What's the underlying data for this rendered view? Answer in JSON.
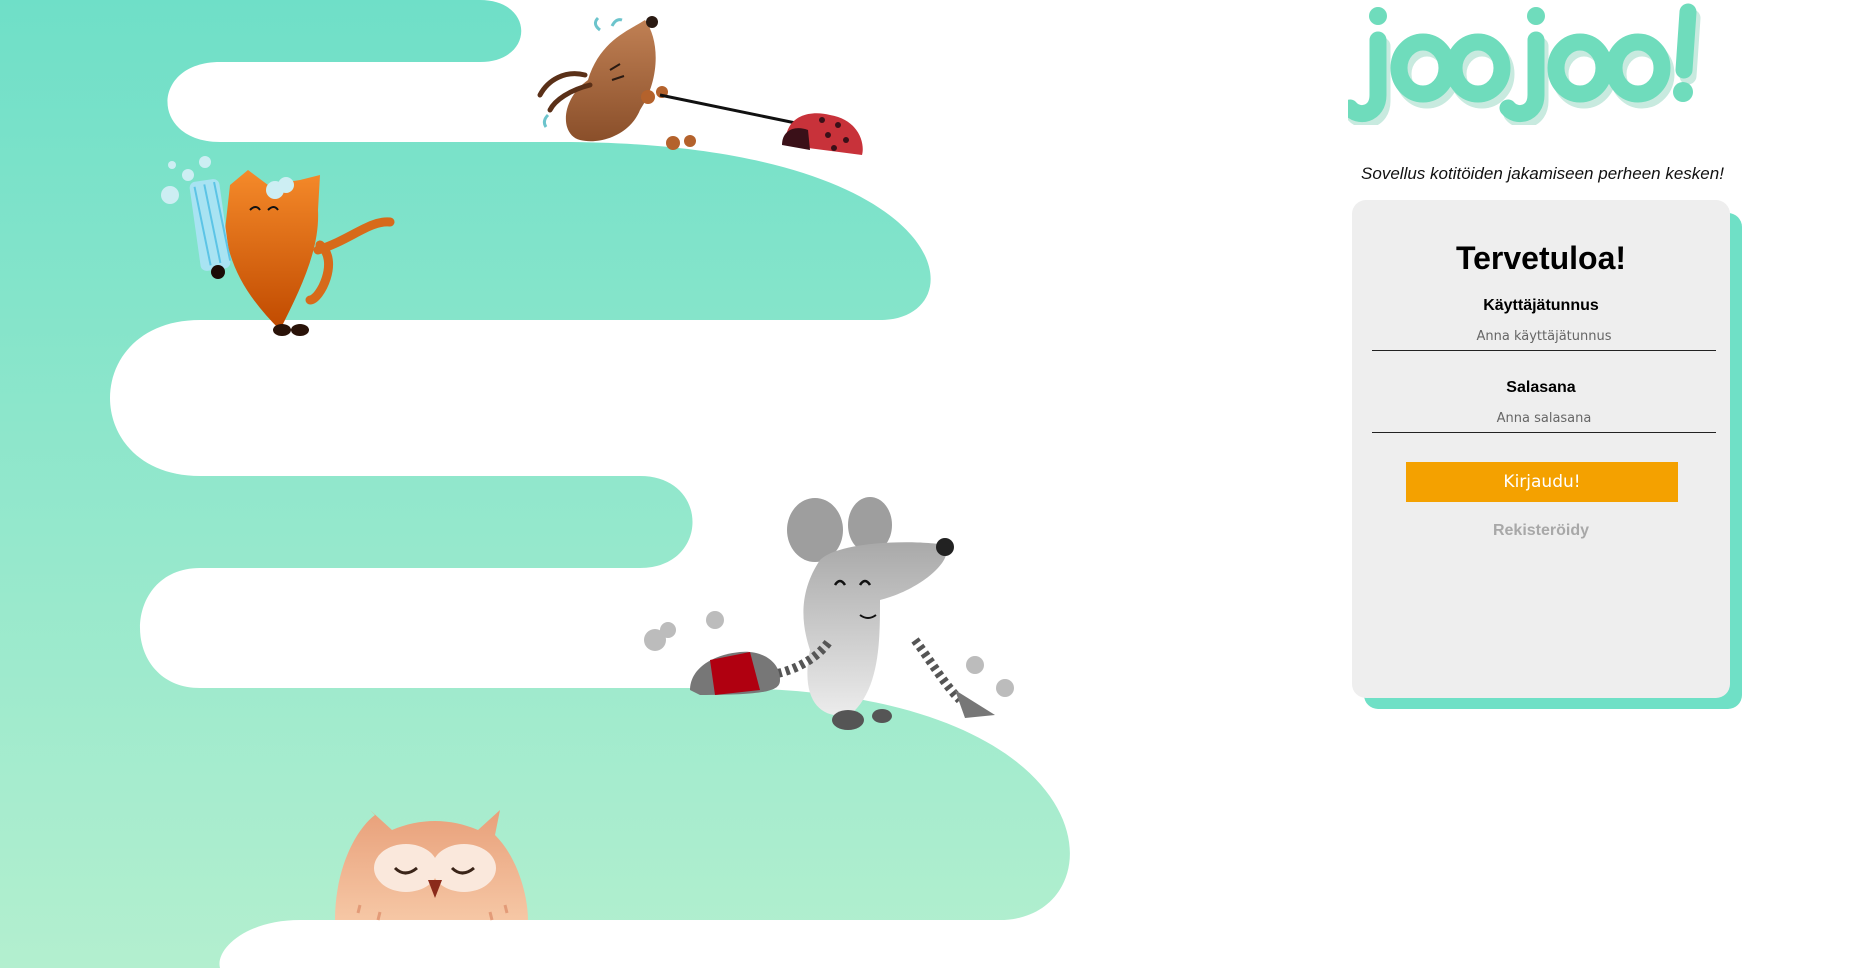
{
  "app": {
    "logo_text": "joojoo!",
    "tagline": "Sovellus kotitöiden jakamiseen perheen kesken!"
  },
  "login": {
    "heading": "Tervetuloa!",
    "username_label": "Käyttäjätunnus",
    "username_placeholder": "Anna käyttäjätunnus",
    "password_label": "Salasana",
    "password_placeholder": "Anna salasana",
    "submit_label": "Kirjaudu!",
    "register_label": "Rekisteröidy"
  },
  "colors": {
    "path_top": "#6fdfc8",
    "path_bottom": "#b3efcf",
    "logo": "#6fdcbc",
    "button": "#f4a100",
    "card": "#eeeeee",
    "card_shadow": "#6fe0c6"
  },
  "illustrations": [
    "dog-with-ladybug",
    "cat-washing-glass",
    "mouse-vacuuming",
    "owl"
  ]
}
